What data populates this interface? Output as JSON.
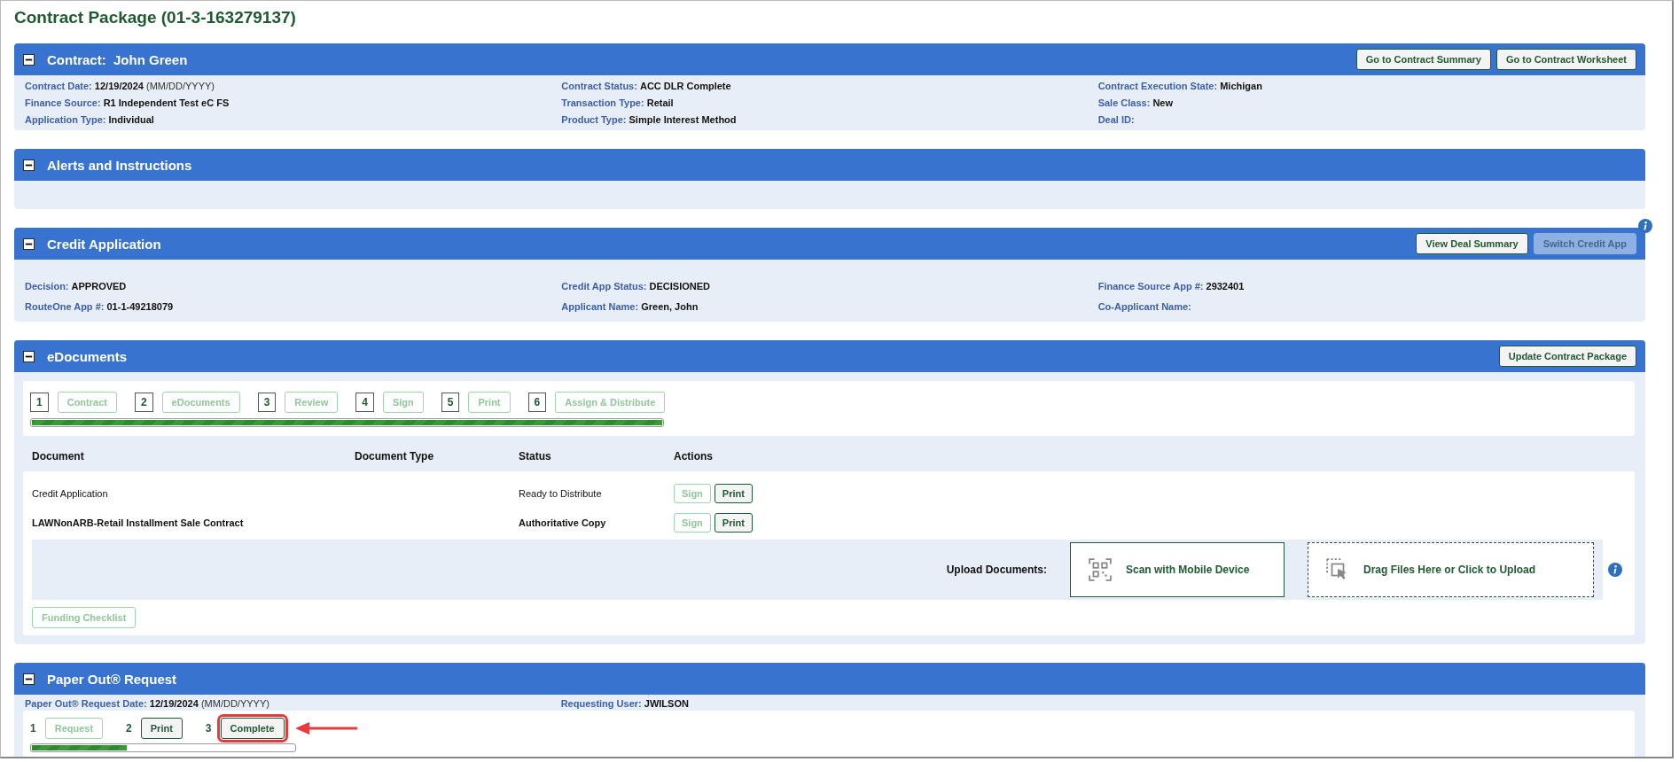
{
  "page_title": "Contract Package (01-3-163279137)",
  "contract": {
    "title": "Contract:  John Green",
    "expanded": true,
    "buttons": [
      {
        "label": "Go to Contract Summary",
        "disabled": false
      },
      {
        "label": "Go to Contract Worksheet",
        "disabled": false
      }
    ],
    "fields": [
      {
        "label": "Contract Date:",
        "value": "12/19/2024",
        "format": "(MM/DD/YYYY)"
      },
      {
        "label": "Contract Status:",
        "value": "ACC DLR Complete"
      },
      {
        "label": "Contract Execution State:",
        "value": "Michigan"
      },
      {
        "label": "Finance Source:",
        "value": "R1 Independent Test eC FS"
      },
      {
        "label": "Transaction Type:",
        "value": "Retail"
      },
      {
        "label": "Sale Class:",
        "value": "New"
      },
      {
        "label": "Application Type:",
        "value": "Individual"
      },
      {
        "label": "Product Type:",
        "value": "Simple Interest Method"
      },
      {
        "label": "Deal ID:"
      }
    ]
  },
  "alerts": {
    "title": "Alerts and Instructions",
    "expanded": true
  },
  "credit_application": {
    "title": "Credit Application",
    "expanded": true,
    "buttons": [
      {
        "label": "View Deal Summary",
        "disabled": false
      },
      {
        "label": "Switch Credit App",
        "disabled": true
      }
    ],
    "fields": [
      {
        "label": "Decision:",
        "value": "APPROVED"
      },
      {
        "label": "Credit App Status:",
        "value": "DECISIONED"
      },
      {
        "label": "Finance Source App #:",
        "value": "2932401"
      },
      {
        "label": "RouteOne App #:",
        "value": "01-1-49218079"
      },
      {
        "label": "Applicant Name:",
        "value": "Green, John"
      },
      {
        "label": "Co-Applicant Name:"
      }
    ]
  },
  "edocuments": {
    "title": "eDocuments",
    "expanded": true,
    "buttons": [
      {
        "label": "Update Contract Package",
        "disabled": false
      }
    ],
    "steps": [
      {
        "number": "1",
        "label": "Contract",
        "disabled": true
      },
      {
        "number": "2",
        "label": "eDocuments",
        "disabled": true
      },
      {
        "number": "3",
        "label": "Review",
        "disabled": true
      },
      {
        "number": "4",
        "label": "Sign",
        "disabled": true
      },
      {
        "number": "5",
        "label": "Print",
        "disabled": true
      },
      {
        "number": "6",
        "label": "Assign & Distribute",
        "disabled": true
      }
    ],
    "progress": {
      "level": 1
    },
    "table": {
      "columns": [
        "Document",
        "Document Type",
        "Status",
        "Actions"
      ],
      "rows": [
        {
          "document": "Credit Application",
          "status": "Ready to Distribute",
          "bold": false,
          "actions": [
            {
              "label": "Sign",
              "disabled": true
            },
            {
              "label": "Print",
              "disabled": false
            }
          ]
        },
        {
          "document": "LAWNonARB-Retail Installment Sale Contract",
          "status": "Authoritative Copy",
          "bold": true,
          "actions": [
            {
              "label": "Sign",
              "disabled": true
            },
            {
              "label": "Print",
              "disabled": false
            }
          ]
        }
      ]
    },
    "upload": {
      "label": "Upload Documents:",
      "scan": "Scan with Mobile Device",
      "drag": "Drag Files Here or  Click to Upload"
    },
    "funding_checklist": {
      "label": "Funding Checklist",
      "disabled": true
    }
  },
  "paper_out": {
    "title": "Paper Out® Request",
    "expanded": true,
    "fields": [
      {
        "label": "Paper Out® Request Date:",
        "value": "12/19/2024",
        "format": "(MM/DD/YYYY)"
      },
      {
        "label": "Requesting User:",
        "value": "JWILSON"
      }
    ],
    "steps": [
      {
        "number": "1",
        "label": "Request",
        "disabled": true,
        "highlighted": false
      },
      {
        "number": "2",
        "label": "Print",
        "disabled": false,
        "highlighted": false
      },
      {
        "number": "3",
        "label": "Complete",
        "disabled": false,
        "highlighted": true
      }
    ],
    "progress": {
      "level": 0.36
    }
  }
}
